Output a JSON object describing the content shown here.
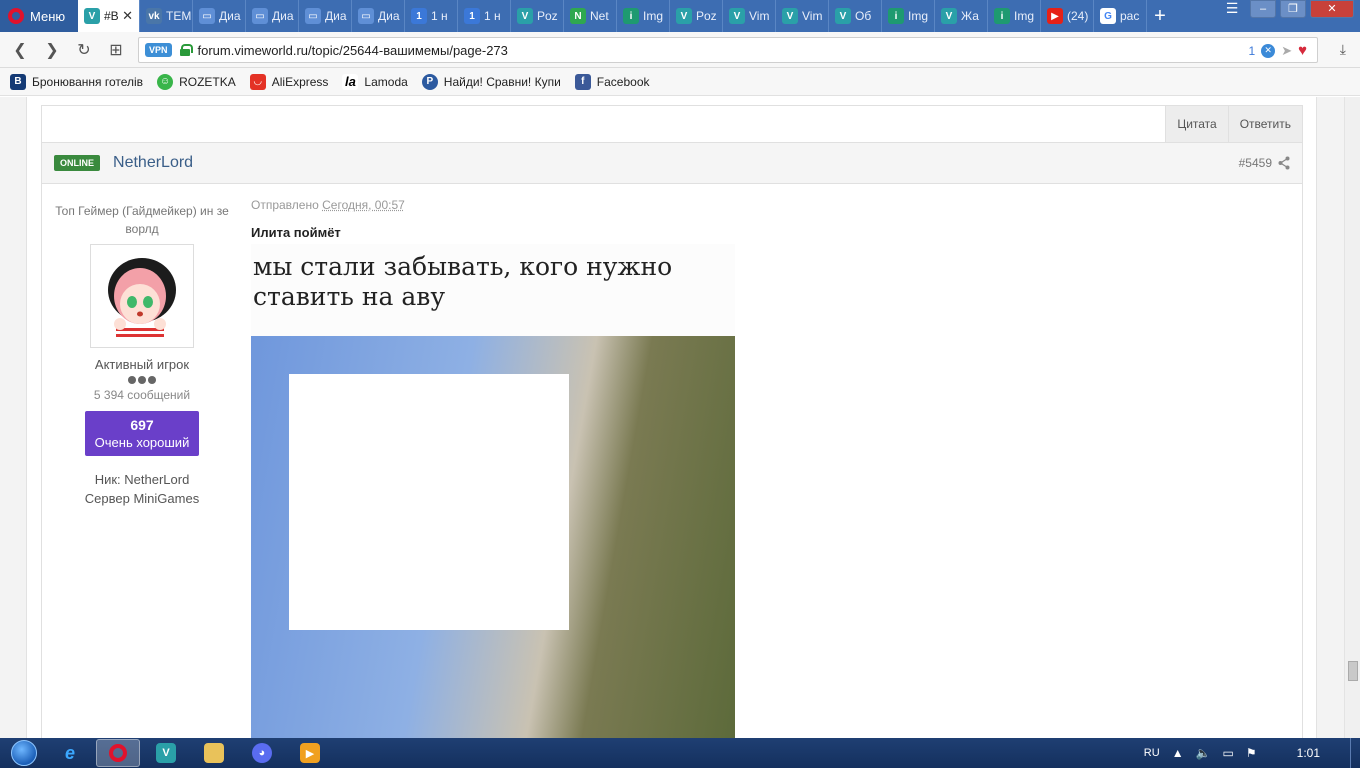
{
  "browser": {
    "menu_label": "Меню",
    "tabs": [
      {
        "label": "#В",
        "icon": "vimeworld-icon",
        "active": true
      },
      {
        "label": "ТЕМ",
        "icon": "vk-icon"
      },
      {
        "label": "Диа",
        "icon": "chat-icon"
      },
      {
        "label": "Диа",
        "icon": "chat-icon"
      },
      {
        "label": "Диа",
        "icon": "chat-icon"
      },
      {
        "label": "Диа",
        "icon": "chat-icon"
      },
      {
        "label": "1 н",
        "icon": "number-one-icon"
      },
      {
        "label": "1 н",
        "icon": "number-one-icon"
      },
      {
        "label": "Poz",
        "icon": "vimeworld-icon"
      },
      {
        "label": "Net",
        "icon": "netherlord-icon"
      },
      {
        "label": "Img",
        "icon": "imgur-icon"
      },
      {
        "label": "Poz",
        "icon": "vimeworld-icon"
      },
      {
        "label": "Vim",
        "icon": "vimeworld-icon"
      },
      {
        "label": "Vim",
        "icon": "vimeworld-icon"
      },
      {
        "label": "Об",
        "icon": "vimeworld-icon"
      },
      {
        "label": "Img",
        "icon": "imgur-icon"
      },
      {
        "label": "Жа",
        "icon": "vimeworld-icon"
      },
      {
        "label": "Img",
        "icon": "imgur-icon"
      },
      {
        "label": "(24)",
        "icon": "youtube-icon"
      },
      {
        "label": "pac",
        "icon": "google-icon"
      }
    ],
    "url": "forum.vimeworld.ru/topic/25644-вашимемы/page-273",
    "vpn_label": "VPN",
    "adblock_count": "1",
    "bookmarks": [
      {
        "label": "Бронювання готелів",
        "icon": "booking-icon"
      },
      {
        "label": "ROZETKA",
        "icon": "rozetka-icon"
      },
      {
        "label": "AliExpress",
        "icon": "aliexpress-icon"
      },
      {
        "label": "Lamoda",
        "icon": "lamoda-icon"
      },
      {
        "label": "Найди! Сравни! Купи",
        "icon": "price-icon"
      },
      {
        "label": "Facebook",
        "icon": "facebook-icon"
      }
    ]
  },
  "previous_post": {
    "quote_label": "Цитата",
    "reply_label": "Ответить"
  },
  "post": {
    "status_badge": "ONLINE",
    "author": "NetherLord",
    "post_number": "#5459",
    "user_title": "Топ Геймер (Гайдмейкер) ин зе ворлд",
    "group": "Активный игрок",
    "post_count": "5 394 сообщений",
    "reputation_value": "697",
    "reputation_label": "Очень хороший",
    "fields": [
      {
        "label": "Ник:",
        "value": "NetherLord"
      },
      {
        "label": "Сервер",
        "value": "MiniGames"
      }
    ],
    "meta_prefix": "Отправлено",
    "meta_date": "Сегодня, 00:57",
    "text": "Илита поймёт",
    "meme_caption": "мы стали забывать, кого нужно ставить на аву"
  },
  "taskbar": {
    "language": "RU",
    "clock": "1:01"
  },
  "colors": {
    "tabbar": "#3d6db2",
    "online": "#3a8a3e",
    "reputation": "#6a3fc9",
    "author_link": "#3a5e88"
  }
}
